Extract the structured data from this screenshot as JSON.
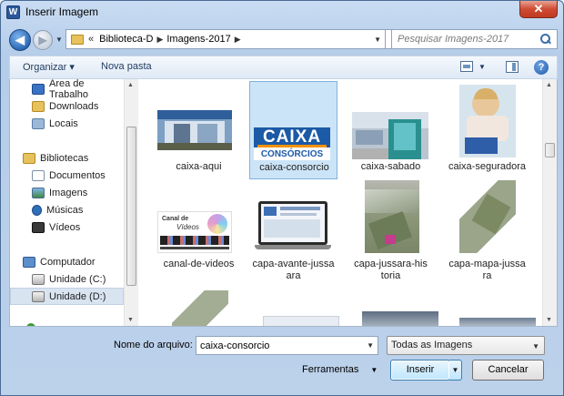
{
  "window": {
    "title": "Inserir Imagem",
    "app_icon": "W",
    "close_label": "✕"
  },
  "address": {
    "chevrons": "«",
    "crumbs": [
      "Biblioteca-D",
      "Imagens-2017"
    ],
    "search_placeholder": "Pesquisar Imagens-2017"
  },
  "toolbar": {
    "organize_label": "Organizar ▾",
    "new_folder_label": "Nova pasta",
    "help_label": "?"
  },
  "nav": {
    "items": [
      {
        "label": "Área de Trabalho",
        "icon": "desktop-icon"
      },
      {
        "label": "Downloads",
        "icon": "downloads-icon"
      },
      {
        "label": "Locais",
        "icon": "places-icon"
      },
      {
        "label": "Bibliotecas",
        "icon": "libraries-icon"
      },
      {
        "label": "Documentos",
        "icon": "documents-icon"
      },
      {
        "label": "Imagens",
        "icon": "pictures-icon"
      },
      {
        "label": "Músicas",
        "icon": "music-icon"
      },
      {
        "label": "Vídeos",
        "icon": "videos-icon"
      },
      {
        "label": "Computador",
        "icon": "computer-icon"
      },
      {
        "label": "Unidade (C:)",
        "icon": "drive-c-icon"
      },
      {
        "label": "Unidade (D:)",
        "icon": "drive-d-icon"
      }
    ]
  },
  "files": [
    {
      "name": "caixa-aqui",
      "line1": "caixa-aqui",
      "line2": ""
    },
    {
      "name": "caixa-consorcio",
      "line1": "caixa-consorcio",
      "line2": "",
      "selected": true
    },
    {
      "name": "caixa-sabado",
      "line1": "caixa-sabado",
      "line2": ""
    },
    {
      "name": "caixa-seguradora",
      "line1": "caixa-seguradora",
      "line2": ""
    },
    {
      "name": "canal-de-videos",
      "line1": "canal-de-videos",
      "line2": ""
    },
    {
      "name": "capa-avante-jussara",
      "line1": "capa-avante-jussa",
      "line2": "ara"
    },
    {
      "name": "capa-jussara-historia",
      "line1": "capa-jussara-his",
      "line2": "toria"
    },
    {
      "name": "capa-mapa-jussara",
      "line1": "capa-mapa-jussa",
      "line2": "ra"
    }
  ],
  "thumbs": {
    "caixa_logo": "CAIXA",
    "caixa_sub": "CONSÓRCIOS",
    "canal_title": "Canal de",
    "canal_sub": "Vídeos"
  },
  "bottom": {
    "filename_label": "Nome do arquivo:",
    "filename_value": "caixa-consorcio",
    "filetype_value": "Todas as Imagens",
    "tools_label": "Ferramentas",
    "insert_label": "Inserir",
    "cancel_label": "Cancelar"
  },
  "colors": {
    "caixa_blue": "#1b5aa6",
    "caixa_orange": "#f39200",
    "selection": "#cce4f7"
  }
}
